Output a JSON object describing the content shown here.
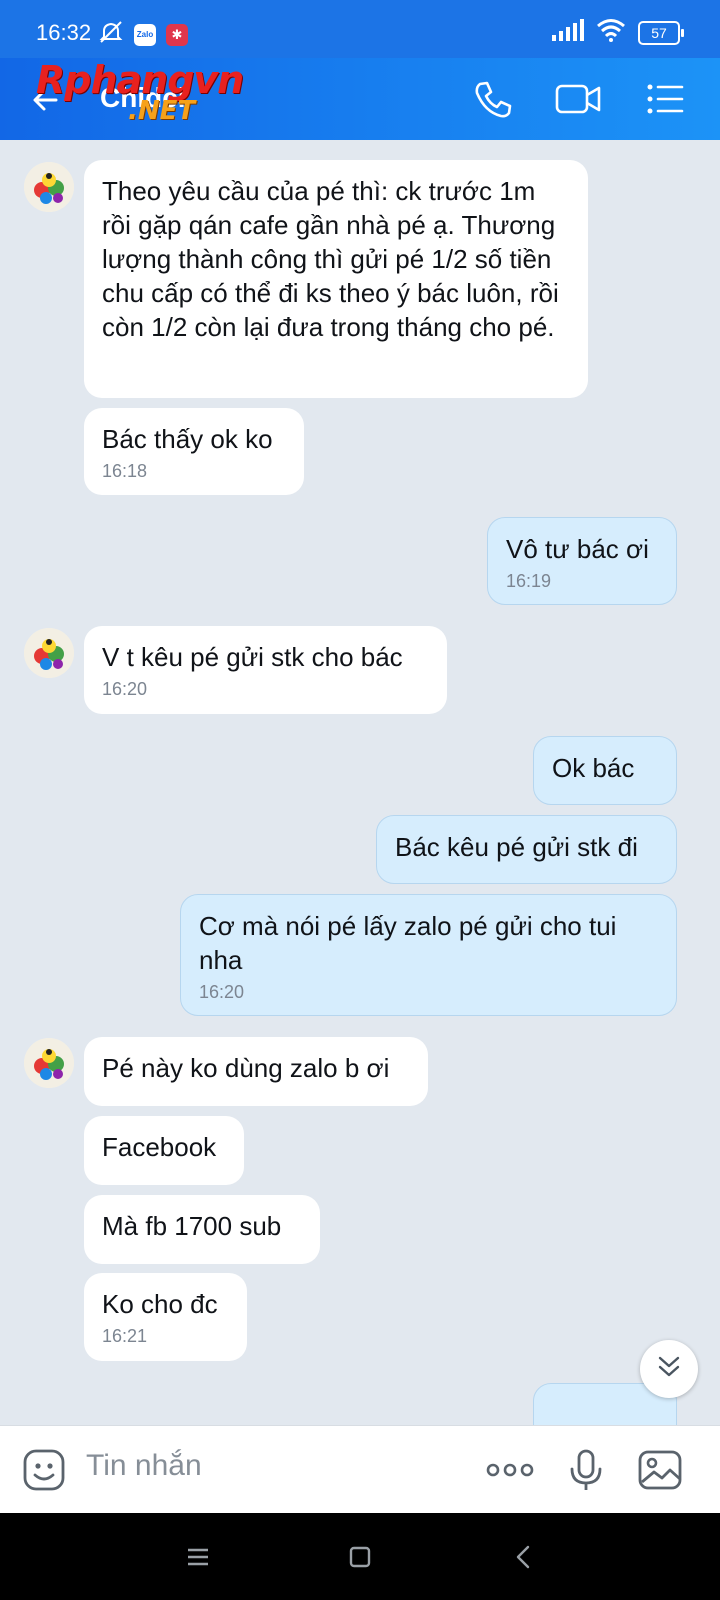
{
  "status_bar": {
    "time": "16:32",
    "battery": "57",
    "app_icon_1": "Zalo",
    "app_icon_2": "✱"
  },
  "watermark": {
    "text": "Rphangvn",
    "suffix": ".NET"
  },
  "header": {
    "contact_name": "Chidci"
  },
  "messages": [
    {
      "dir": "in",
      "text": "Theo yêu cầu của pé thì: ck trước 1m rồi gặp qán cafe gần nhà pé ạ. Thương lượng thành công thì gửi pé 1/2 số tiền chu cấp có thể đi ks theo ý bác luôn, rồi còn 1/2 còn lại đưa trong tháng cho pé.",
      "time": ""
    },
    {
      "dir": "in",
      "text": "Bác thấy ok ko",
      "time": "16:18"
    },
    {
      "dir": "out",
      "text": "Vô tư bác ơi",
      "time": "16:19"
    },
    {
      "dir": "in",
      "text": "V t kêu pé gửi stk cho bác",
      "time": "16:20"
    },
    {
      "dir": "out",
      "text": "Ok bác",
      "time": ""
    },
    {
      "dir": "out",
      "text": "Bác kêu pé gửi stk đi",
      "time": ""
    },
    {
      "dir": "out",
      "text": "Cơ mà nói pé lấy zalo pé gửi cho tui nha",
      "time": "16:20"
    },
    {
      "dir": "in",
      "text": "Pé này ko dùng zalo b ơi",
      "time": ""
    },
    {
      "dir": "in",
      "text": "Facebook",
      "time": ""
    },
    {
      "dir": "in",
      "text": "Mà fb 1700 sub",
      "time": ""
    },
    {
      "dir": "in",
      "text": "Ko cho đc",
      "time": "16:21"
    }
  ],
  "composer": {
    "placeholder": "Tin nhắn"
  },
  "icons": [
    "back-arrow-icon",
    "phone-call-icon",
    "video-call-icon",
    "menu-list-icon",
    "emoji-sticker-icon",
    "more-dots-icon",
    "microphone-icon",
    "image-gallery-icon",
    "double-chevron-down-icon",
    "nav-menu-icon",
    "nav-home-icon",
    "nav-back-icon"
  ],
  "colors": {
    "header_start": "#1267e6",
    "header_end": "#1c93f7",
    "incoming_bubble": "#ffffff",
    "outgoing_bubble": "#d6edfd",
    "chat_bg": "#e2e8ef"
  }
}
